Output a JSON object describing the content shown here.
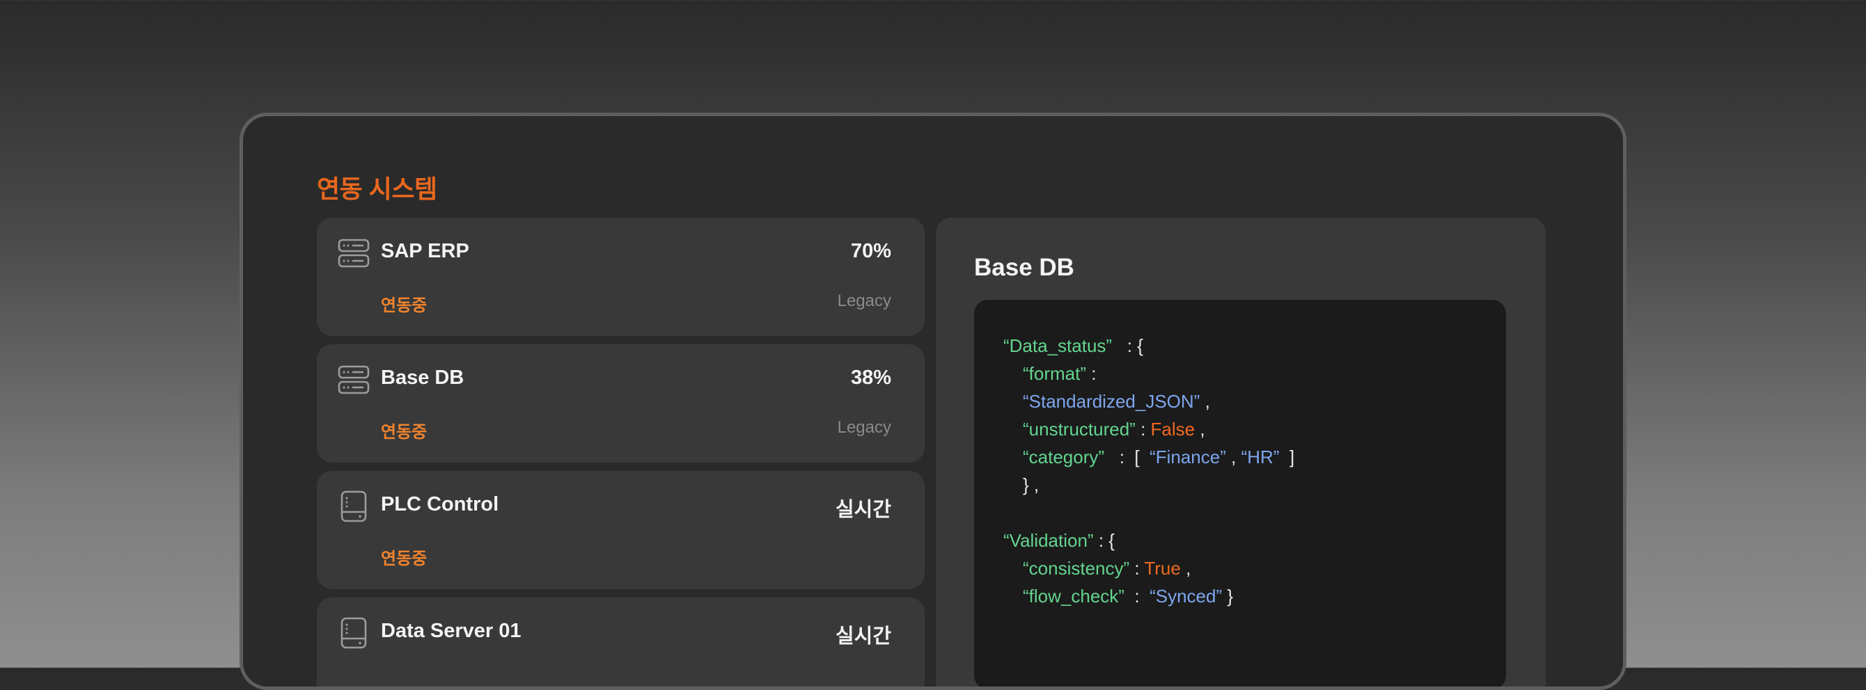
{
  "section_title": "연동 시스템",
  "systems": [
    {
      "name": "SAP ERP",
      "value": "70%",
      "status": "연동중",
      "type": "Legacy",
      "icon": "server-stack-icon"
    },
    {
      "name": "Base DB",
      "value": "38%",
      "status": "연동중",
      "type": "Legacy",
      "icon": "server-stack-icon"
    },
    {
      "name": "PLC Control",
      "value": "실시간",
      "status": "연동중",
      "type": "",
      "icon": "device-icon"
    },
    {
      "name": "Data Server 01",
      "value": "실시간",
      "status": "",
      "type": "",
      "icon": "device-icon"
    }
  ],
  "detail": {
    "title": "Base DB",
    "code": {
      "data_status_key": "“Data_status”",
      "format_key": "“format”",
      "format_value": "“Standardized_JSON”",
      "unstructured_key": "“unstructured”",
      "unstructured_value": "False",
      "category_key": "“category”",
      "category_values": [
        "“Finance”",
        "“HR”"
      ],
      "validation_key": "“Validation”",
      "consistency_key": "“consistency”",
      "consistency_value": "True",
      "flow_check_key": "“flow_check”",
      "flow_check_value": "“Synced”"
    }
  },
  "colors": {
    "accent": "#e8671e",
    "status": "#f0842e",
    "json_key": "#63d58f",
    "json_string": "#7ea6ee",
    "json_bool": "#ef6a22"
  }
}
